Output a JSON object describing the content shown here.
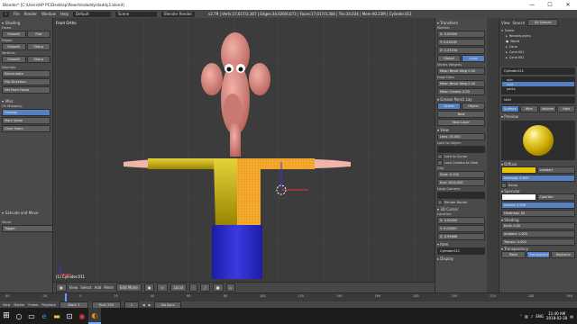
{
  "window": {
    "title": "Blender* [C:\\Users\\HP PC\\Desktop\\Rewrite\\daddy\\daddy2.blend]",
    "controls": [
      "—",
      "☐",
      "✕"
    ]
  },
  "topbar": {
    "info_icon": "i",
    "menus": [
      "File",
      "Render",
      "Window",
      "Help"
    ],
    "layout": "Default",
    "scene": "Scene",
    "engine": "Blender Render",
    "stats": "v2.79 | Verts:17,617/3,367 | Edges:34,626/6,673 | Faces:17,017/3,304 | Tris:34,034 | Mem:40.23M | Cylinder.011"
  },
  "toolshelf": {
    "sections": [
      {
        "title": "Shading",
        "rows": [
          {
            "label": "Faces:",
            "buttons": [
              "Smooth",
              "Flat"
            ]
          },
          {
            "label": "Edges:",
            "buttons": [
              "Smooth",
              "Sharp"
            ]
          },
          {
            "label": "Vertices:",
            "buttons": [
              "Smooth",
              "Sharp"
            ]
          }
        ]
      },
      {
        "title": "",
        "rows": [
          {
            "label": "",
            "buttons": [
              "Normals:"
            ]
          },
          {
            "label": "",
            "buttons": [
              "Recalculate"
            ]
          },
          {
            "label": "",
            "buttons": [
              "Flip Direction"
            ]
          },
          {
            "label": "",
            "buttons": [
              "Set From Faces"
            ]
          }
        ]
      },
      {
        "title": "Misc",
        "rows": [
          {
            "label": "UV Mapping:",
            "buttons": [
              "Unwrap"
            ]
          },
          {
            "label": "",
            "buttons": [
              "Mark Seam"
            ]
          },
          {
            "label": "",
            "buttons": [
              "Clear Seam"
            ]
          }
        ]
      }
    ],
    "operator_title": "Extrude and Move",
    "operator_field_label": "Mirror",
    "operator_value": "Toggle"
  },
  "viewport": {
    "view_label": "Front Ortho",
    "object_label": "(1) Cylinder.011",
    "header": {
      "view_menu": "View",
      "select_menu": "Select",
      "add_menu": "Add",
      "mesh_menu": "Mesh",
      "mode": "Edit Mode",
      "pivot": "Local",
      "snap": "No Sync"
    }
  },
  "npanel": {
    "transform_title": "Transform",
    "median_label": "Median:",
    "x": "X:  0.00000",
    "y": "Y:  0.04516",
    "z": "Z:  1.23154",
    "global": "Global",
    "local": "Local",
    "vertex_weights": "Vertex Weights",
    "bevel_weight": "Mean Bevel Weig 0.00",
    "crease": "Mean Crease: 0.00",
    "edge_data": "Edge Data",
    "edge_bevel": "Mean Bevel Weig 0.00",
    "edge_crease": "Mean Crease: 0.00",
    "grease_pencil": "Grease Pencil Lay",
    "scene": "Scene",
    "object": "Object",
    "new": "New",
    "new_layer": "New Layer",
    "view_title": "View",
    "lens": "Lens: 35.000",
    "lock_to_object": "Lock to Object:",
    "lock_cursor": "Lock to Cursor",
    "lock_camera": "Lock Camera to View",
    "clip": "Clip:",
    "clip_start": "Start: 0.100",
    "clip_end": "End: 1000.000",
    "local_camera": "Local Camera:",
    "render_border": "Render Border",
    "cursor3d": "3D Cursor",
    "location": "Location:",
    "cx": "X: 0.00000",
    "cy": "Y: 0.00000",
    "cz": "Z: 0.99668",
    "item": "Item",
    "item_name": "Cylinder.011",
    "display": "Display"
  },
  "outliner": {
    "view": "View",
    "search": "Search",
    "all_scenes": "All Scenes",
    "items": [
      "Scene",
      "RenderLayers",
      "World",
      "Cone",
      "Cone.001",
      "Cone.002"
    ]
  },
  "properties": {
    "object_name": "Cylinder.011",
    "slots": [
      "skin",
      "shirt",
      "pants"
    ],
    "selected_slot": "shirt",
    "material_name": "shirt",
    "tabs": [
      "Surface",
      "Wire",
      "Volume",
      "Halo"
    ],
    "active_tab": "Surface",
    "preview_title": "Preview",
    "diffuse": "Diffuse",
    "diffuse_shader": "Lambert",
    "intensity": "Intensity: 0.800",
    "ramp": "Ramp",
    "specular": "Specular",
    "specular_shader": "CookTorr",
    "spec_intensity": "Intensi: 0.500",
    "hardness": "Hardness: 50",
    "shading": "Shading",
    "emit": "Emit: 0.00",
    "ambient": "Ambient 1.000",
    "translucency": "Translu: 0.000",
    "shadeless": "Shadeless",
    "tangent": "Tangent Shad",
    "cubic": "Cubic Interpo",
    "transparency": "Transparency",
    "mask": "Mask",
    "z_transparency": "Z Transparency",
    "raytrace": "Raytrace",
    "colors": {
      "shirt": "#e8c500",
      "specular": "#ffffff"
    }
  },
  "timeline": {
    "ticks": [
      "-40",
      "-20",
      "0",
      "20",
      "40",
      "60",
      "80",
      "100",
      "120",
      "140",
      "160",
      "180",
      "200",
      "220",
      "240",
      "260"
    ],
    "view": "View",
    "marker": "Marker",
    "frame": "Frame",
    "playback": "Playback",
    "start": "Start: 1",
    "end": "End: 250",
    "current": "1",
    "sync": "No Sync"
  },
  "taskbar": {
    "time": "11:40 AM",
    "date": "2018-02-28",
    "lang": "ENG",
    "icons": [
      "search-icon",
      "task-view-icon",
      "edge-icon",
      "folder-icon",
      "store-icon",
      "chrome-icon",
      "blender-icon"
    ],
    "active_icon": "blender-icon"
  }
}
